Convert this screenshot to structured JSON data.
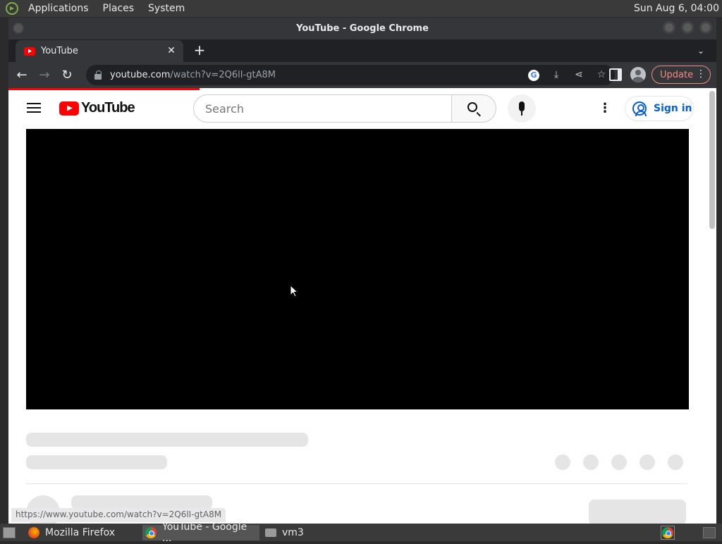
{
  "system_panel": {
    "menus": [
      "Applications",
      "Places",
      "System"
    ],
    "clock": "Sun Aug  6, 04:00"
  },
  "window": {
    "title": "YouTube - Google Chrome"
  },
  "tab": {
    "title": "YouTube",
    "close_glyph": "✕",
    "new_tab_glyph": "+",
    "tab_search_glyph": "⌄"
  },
  "toolbar": {
    "back_glyph": "←",
    "forward_glyph": "→",
    "reload_glyph": "↻",
    "url_host": "youtube.com",
    "url_path": "/watch?v=2Q6lI-gtA8M",
    "g_glyph": "G",
    "install_glyph": "⤓",
    "share_glyph": "⋖",
    "bookmark_glyph": "☆",
    "update_label": "Update",
    "menu_glyph": "⋮"
  },
  "youtube": {
    "logo_text": "YouTube",
    "search_placeholder": "Search",
    "more_glyph": "⋮",
    "signin_label": "Sign in",
    "loading_progress": 0.27
  },
  "status_bar": {
    "link": "https://www.youtube.com/watch?v=2Q6lI-gtA8M"
  },
  "taskbar": {
    "items": [
      "Mozilla Firefox",
      "YouTube - Google ...",
      "vm3"
    ]
  },
  "colors": {
    "youtube_red": "#ff0000",
    "link_blue": "#065fd4",
    "chrome_dark": "#35363a",
    "update_red": "#f28b82"
  }
}
